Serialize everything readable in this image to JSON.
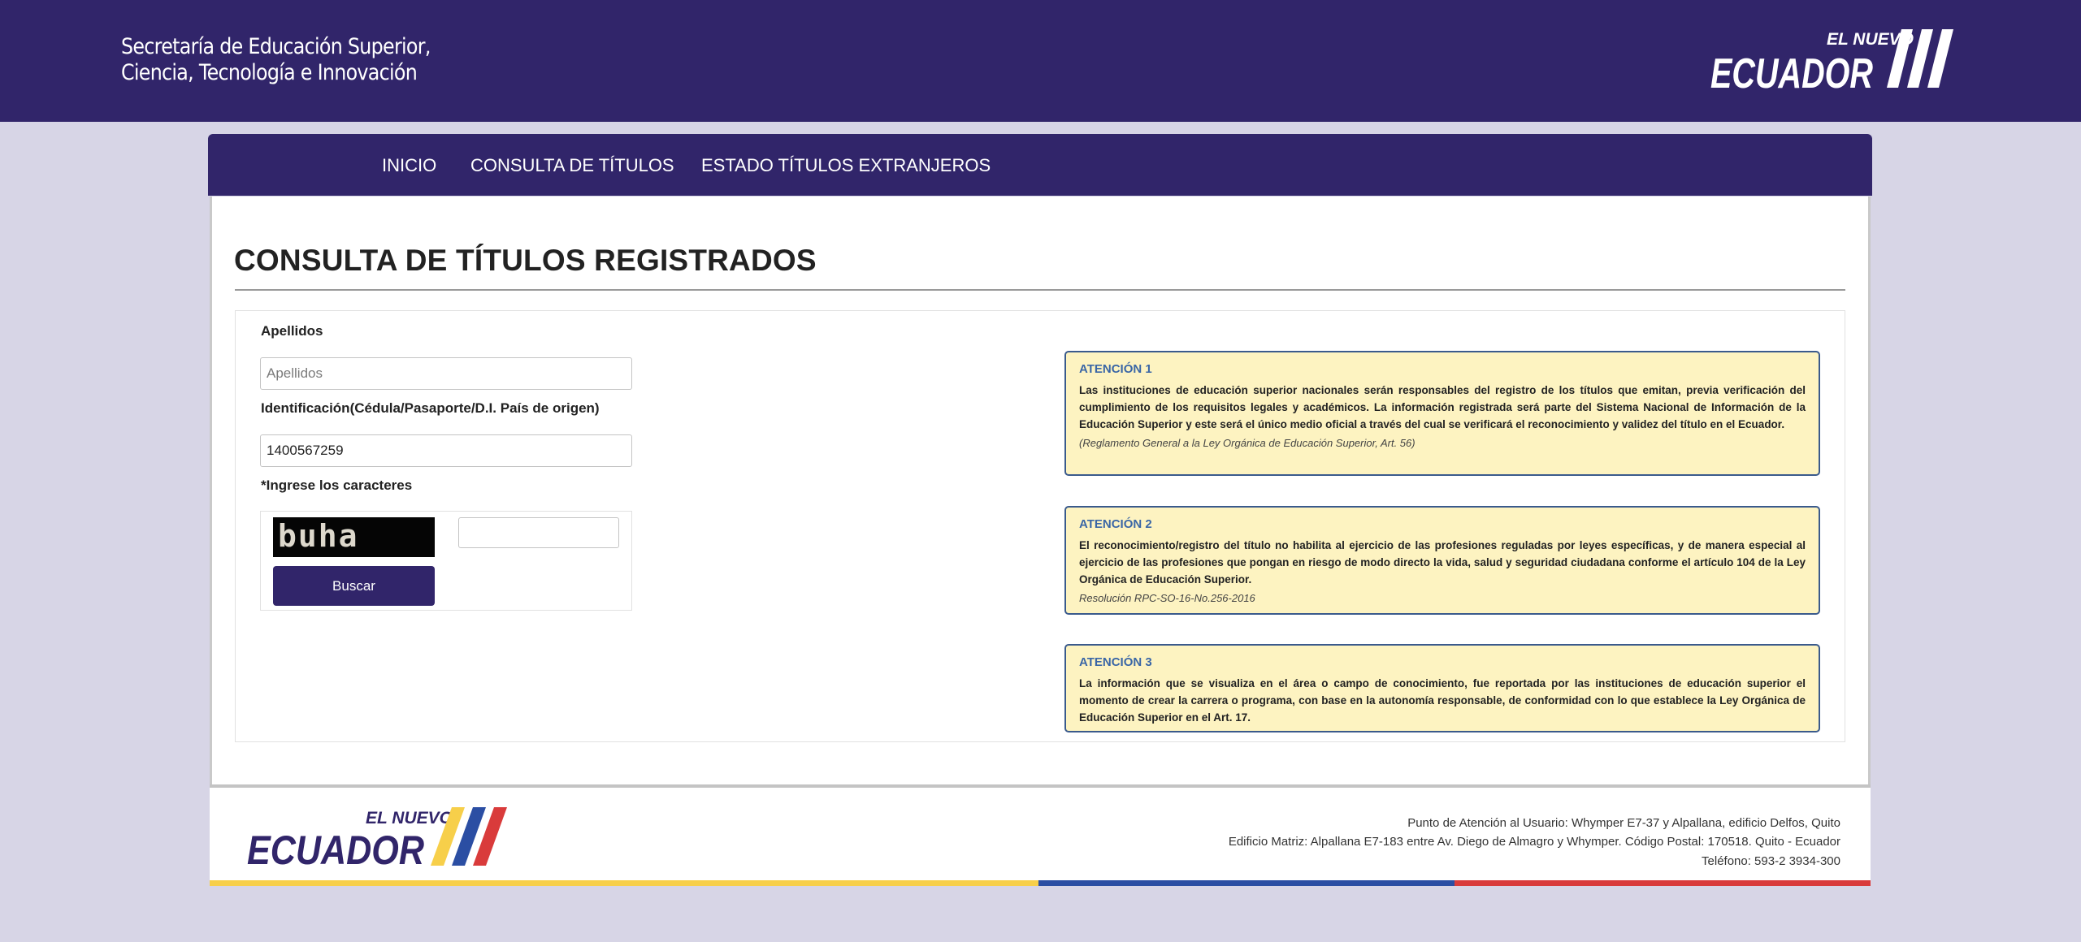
{
  "header": {
    "ministry_line1": "Secretaría de Educación Superior,",
    "ministry_line2": "Ciencia, Tecnología e Innovación",
    "logo_small": "EL NUEVO",
    "logo_big": "ECUADOR"
  },
  "nav": {
    "items": [
      {
        "label": "INICIO"
      },
      {
        "label": "CONSULTA DE TÍTULOS"
      },
      {
        "label": "ESTADO TÍTULOS EXTRANJEROS"
      }
    ]
  },
  "page": {
    "title": "CONSULTA DE TÍTULOS REGISTRADOS"
  },
  "form": {
    "apellidos_label": "Apellidos",
    "apellidos_placeholder": "Apellidos",
    "apellidos_value": "",
    "id_label": "Identificación(Cédula/Pasaporte/D.I. País de origen)",
    "id_value": "1400567259",
    "captcha_required_mark": "*",
    "captcha_label": "Ingrese los caracteres",
    "captcha_text": "buha",
    "captcha_value": "",
    "search_button": "Buscar"
  },
  "alerts": [
    {
      "title": "ATENCIÓN 1",
      "body": "Las instituciones de educación superior nacionales serán responsables del registro de los títulos que emitan, previa verificación del cumplimiento de los requisitos legales y académicos. La información registrada será parte del Sistema Nacional de Información de la Educación Superior y este será el único medio oficial a través del cual se verificará el reconocimiento y validez del título en el Ecuador.",
      "note": "(Reglamento General a la Ley Orgánica de Educación Superior, Art. 56)"
    },
    {
      "title": "ATENCIÓN 2",
      "body": "El reconocimiento/registro del título no habilita al ejercicio de las profesiones reguladas por leyes específicas, y de manera especial al ejercicio de las profesiones que pongan en riesgo de modo directo la vida, salud y seguridad ciudadana conforme el artículo 104 de la Ley Orgánica de Educación Superior.",
      "note": "Resolución RPC-SO-16-No.256-2016"
    },
    {
      "title": "ATENCIÓN 3",
      "body": "La información que se visualiza en el área o campo de conocimiento, fue reportada por las instituciones de educación superior el momento de crear la carrera o programa, con base en la autonomía responsable, de conformidad con lo que establece la Ley Orgánica de Educación Superior en el Art. 17."
    }
  ],
  "footer": {
    "address1": "Punto de Atención al Usuario: Whymper E7-37 y Alpallana, edificio Delfos, Quito",
    "address2": "Edificio Matriz: Alpallana E7-183 entre Av. Diego de Almagro y Whymper. Código Postal: 170518. Quito - Ecuador",
    "phone": "Teléfono: 593-2 3934-300"
  },
  "colors": {
    "brand_purple": "#31256a",
    "flag_yellow": "#f7cf4a",
    "flag_blue": "#2b4ea3",
    "flag_red": "#d93b3b",
    "alert_bg": "#fdf3c1",
    "alert_border": "#3a5a8c"
  }
}
